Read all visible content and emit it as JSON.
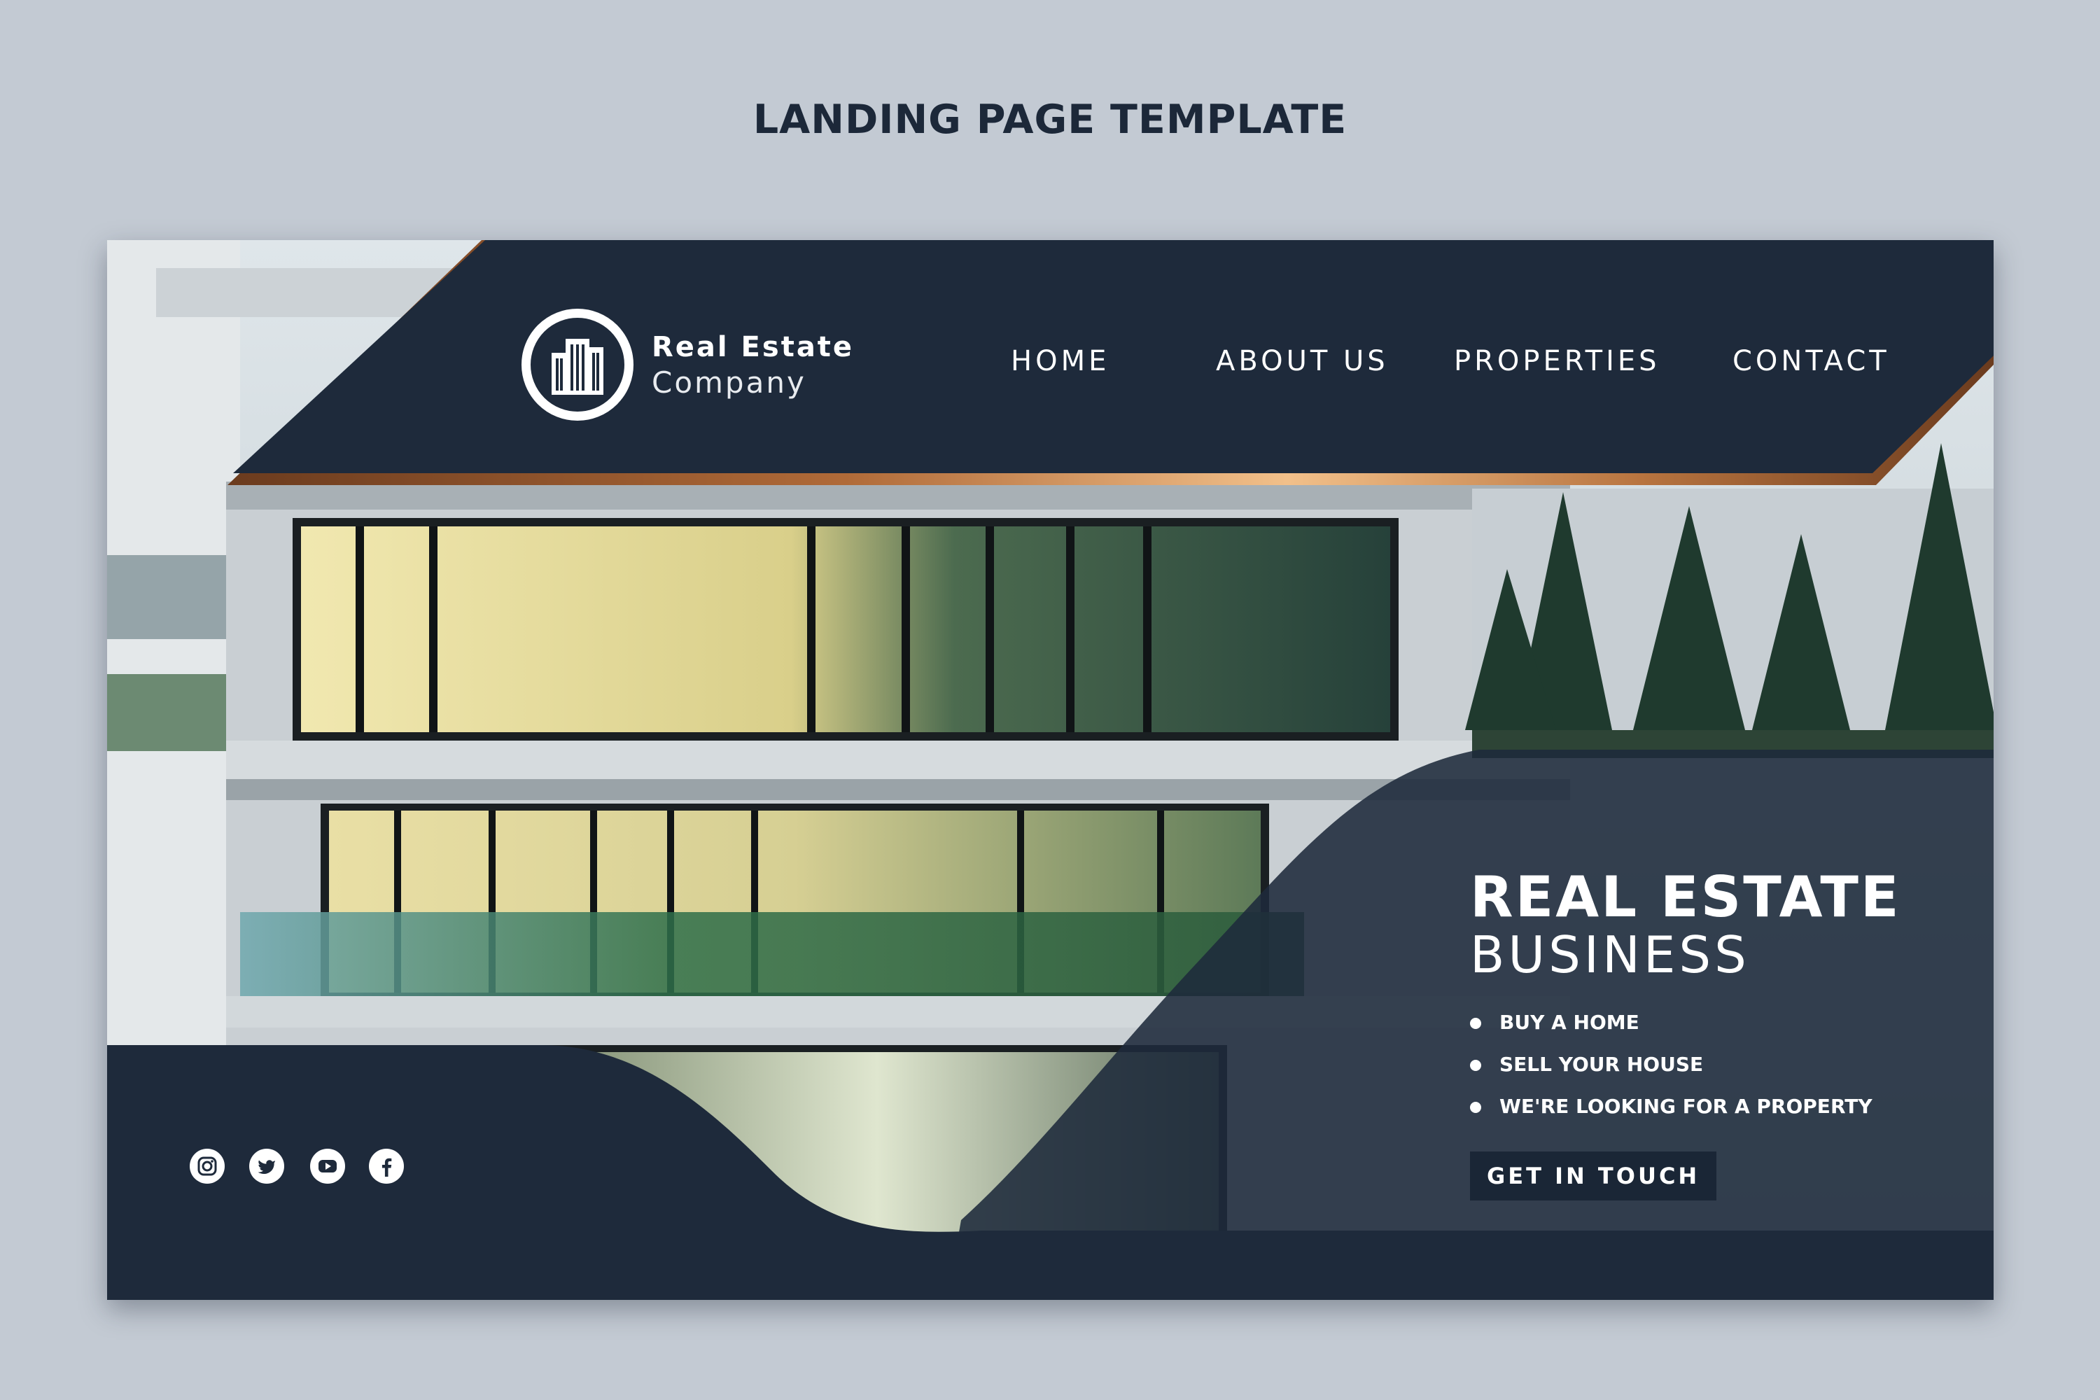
{
  "page_heading": "LANDING PAGE TEMPLATE",
  "colors": {
    "navy": "#1e2a3b",
    "background": "#c3cad3",
    "copper": "#c07a45",
    "copper_highlight": "#f2c08a",
    "white": "#ffffff"
  },
  "logo": {
    "icon": "building-icon",
    "line1": "Real Estate",
    "line2": "Company"
  },
  "nav": {
    "items": [
      {
        "label": "HOME"
      },
      {
        "label": "ABOUT US"
      },
      {
        "label": "PROPERTIES"
      },
      {
        "label": "CONTACT"
      }
    ]
  },
  "hero": {
    "title_line1": "REAL ESTATE",
    "title_line2": "BUSINESS",
    "bullets": [
      "BUY A HOME",
      "SELL YOUR HOUSE",
      "WE'RE LOOKING FOR A PROPERTY"
    ],
    "cta_label": "GET IN TOUCH"
  },
  "social": {
    "icons": [
      "instagram-icon",
      "twitter-icon",
      "youtube-icon",
      "facebook-icon"
    ]
  }
}
